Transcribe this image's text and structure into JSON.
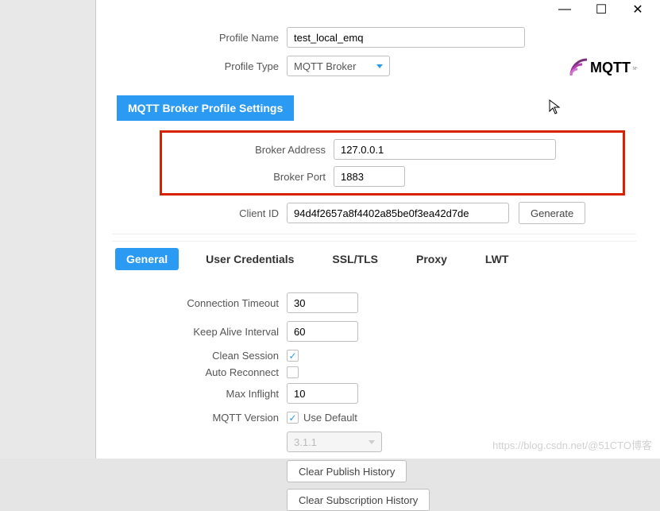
{
  "window": {
    "minimize": "—",
    "maximize": "☐",
    "close": "✕"
  },
  "profile": {
    "name_label": "Profile Name",
    "name_value": "test_local_emq",
    "type_label": "Profile Type",
    "type_value": "MQTT Broker"
  },
  "logo": {
    "brand": "MQTT",
    "sub": ".fx"
  },
  "section": {
    "title": "MQTT Broker Profile Settings"
  },
  "broker": {
    "address_label": "Broker Address",
    "address_value": "127.0.0.1",
    "port_label": "Broker Port",
    "port_value": "1883"
  },
  "client": {
    "id_label": "Client ID",
    "id_value": "94d4f2657a8f4402a85be0f3ea42d7de",
    "generate": "Generate"
  },
  "tabs": {
    "general": "General",
    "credentials": "User Credentials",
    "ssl": "SSL/TLS",
    "proxy": "Proxy",
    "lwt": "LWT"
  },
  "settings": {
    "conn_timeout_label": "Connection Timeout",
    "conn_timeout_value": "30",
    "keepalive_label": "Keep Alive Interval",
    "keepalive_value": "60",
    "clean_session_label": "Clean Session",
    "clean_session_checked": "✓",
    "auto_reconnect_label": "Auto Reconnect",
    "max_inflight_label": "Max Inflight",
    "max_inflight_value": "10",
    "mqtt_version_label": "MQTT Version",
    "use_default_label": "Use Default",
    "use_default_checked": "✓",
    "mqtt_version_value": "3.1.1",
    "clear_publish": "Clear Publish History",
    "clear_sub": "Clear Subscription History"
  },
  "watermark": "https://blog.csdn.net/@51CTO博客"
}
